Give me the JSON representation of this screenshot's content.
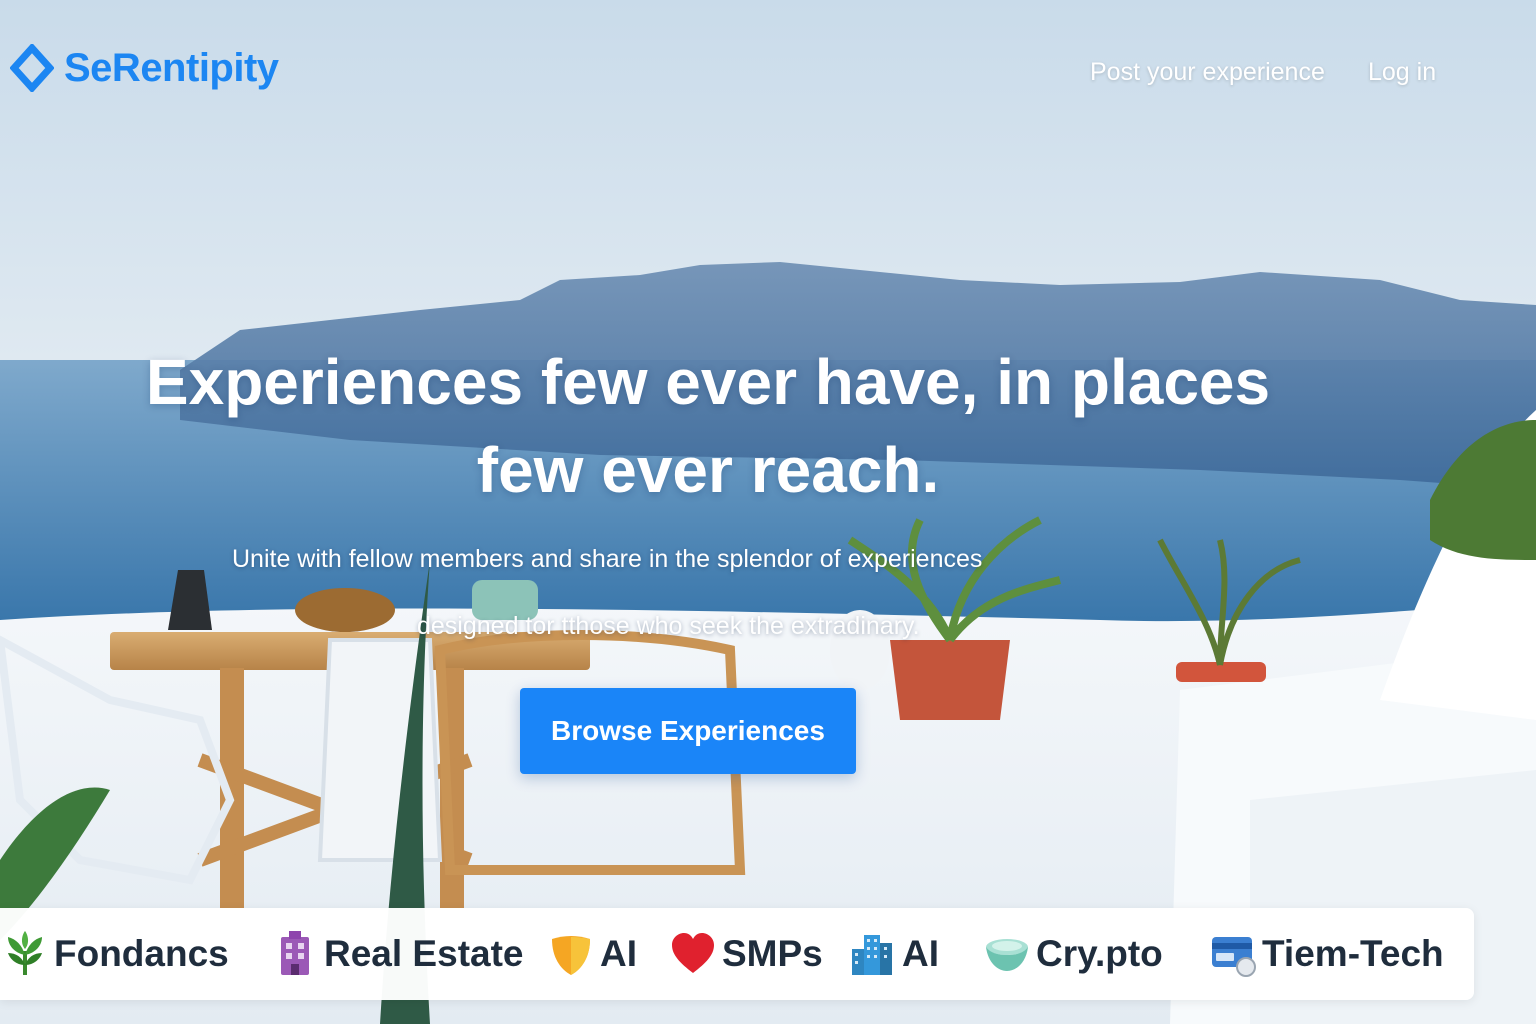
{
  "brand": {
    "name": "SeRentipity",
    "color": "#1c86f2"
  },
  "nav": {
    "post_label": "Post your experience",
    "login_label": "Log in"
  },
  "hero": {
    "title_line1": "Experiences few ever have, in places",
    "title_line2": "few ever reach.",
    "subtitle_line1": "Unite with fellow members and share in the splendor of experiences",
    "subtitle_line2": "designed tor tthose who seek the extradinary.",
    "cta_label": "Browse Experiences",
    "cta_color": "#1a85f8"
  },
  "categories": [
    {
      "label": "Fondancs",
      "icon": "plant-icon"
    },
    {
      "label": "Real Estate",
      "icon": "building-icon"
    },
    {
      "label": "AI",
      "icon": "shield-icon"
    },
    {
      "label": "SMPs",
      "icon": "heart-icon"
    },
    {
      "label": "AI",
      "icon": "city-icon"
    },
    {
      "label": "Cry.pto",
      "icon": "bowl-icon"
    },
    {
      "label": "Tiem-Tech",
      "icon": "card-icon"
    }
  ]
}
